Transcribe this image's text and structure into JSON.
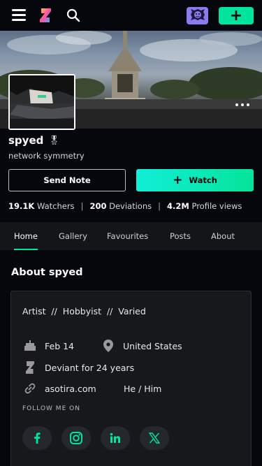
{
  "topbar": {
    "menu_icon": "hamburger-icon",
    "logo_icon": "deviantart-logo-icon",
    "search_icon": "search-icon",
    "user_icon": "avatar-mascot-icon",
    "create_label": "+"
  },
  "profile": {
    "username": "spyed",
    "badge_icon": "medal-icon",
    "badge_glyph": "🎖",
    "tagline": "network symmetry",
    "send_note_label": "Send Note",
    "watch_label": "Watch",
    "watch_plus": "+"
  },
  "stats": {
    "watchers_count": "19.1K",
    "watchers_label": "Watchers",
    "deviations_count": "200",
    "deviations_label": "Deviations",
    "views_count": "4.2M",
    "views_label": "Profile views",
    "separator": "|"
  },
  "tabs": [
    {
      "label": "Home",
      "active": true
    },
    {
      "label": "Gallery",
      "active": false
    },
    {
      "label": "Favourites",
      "active": false
    },
    {
      "label": "Posts",
      "active": false
    },
    {
      "label": "About",
      "active": false
    }
  ],
  "about": {
    "title": "About spyed",
    "roles": "Artist  //  Hobbyist  //  Varied",
    "birthday": "Feb 14",
    "location": "United States",
    "deviant_since": "Deviant for 24 years",
    "website": "asotira.com",
    "pronouns": "He / Him",
    "follow_label": "FOLLOW ME ON"
  },
  "socials": [
    {
      "icon": "facebook-icon"
    },
    {
      "icon": "instagram-icon"
    },
    {
      "icon": "linkedin-icon"
    },
    {
      "icon": "x-twitter-icon"
    }
  ],
  "colors": {
    "background": "#06070d",
    "accent": "#00e59b",
    "accent_cyan": "#12eed8",
    "avatar_button": "#8a7cf0",
    "social_icon": "#00e59b"
  }
}
